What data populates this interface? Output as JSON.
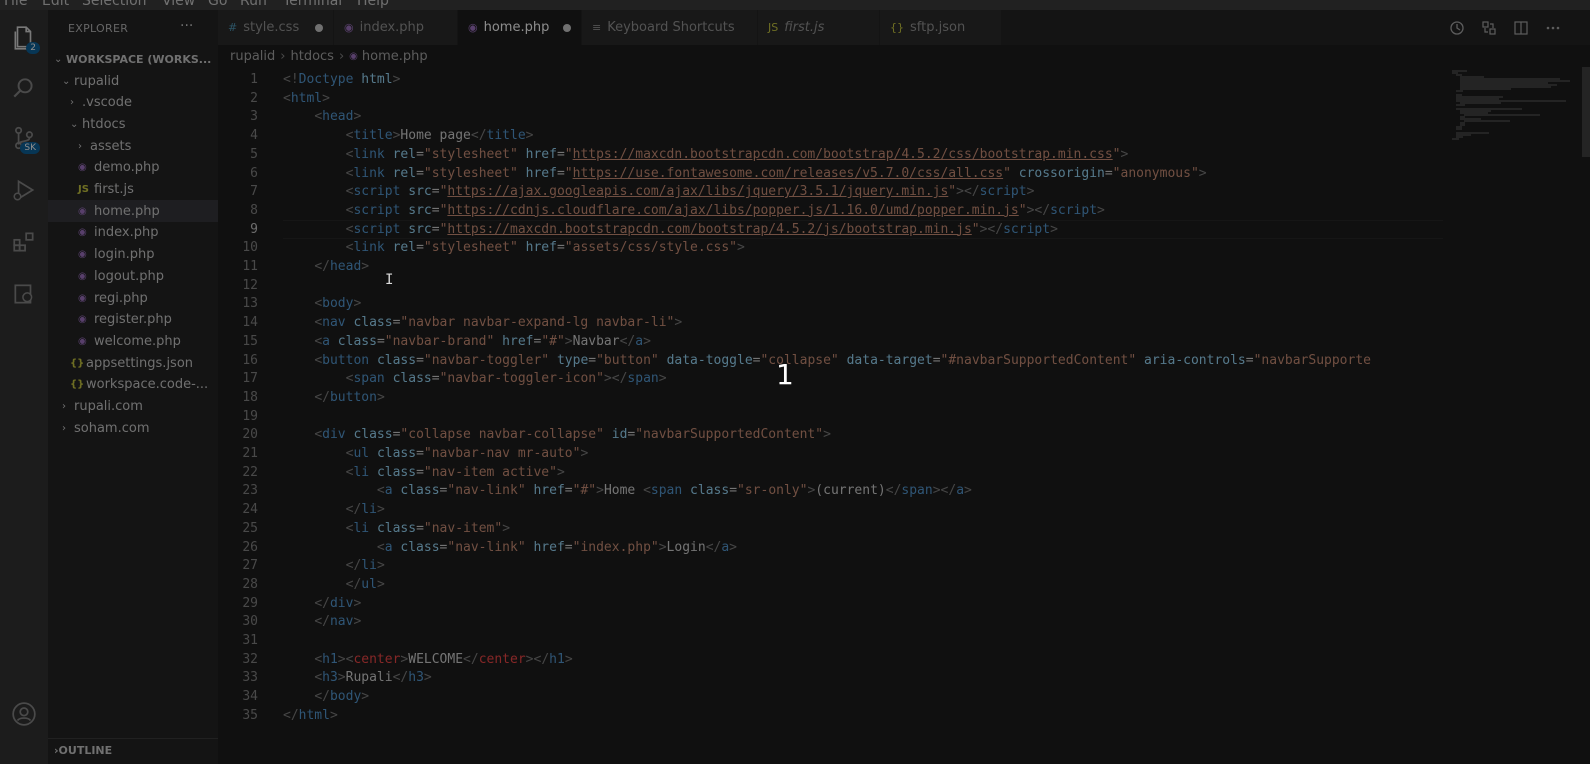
{
  "menu": [
    "File",
    "Edit",
    "Selection",
    "View",
    "Go",
    "Run",
    "Terminal",
    "Help"
  ],
  "activity_badges": {
    "explorer": "2",
    "source_control": "SK"
  },
  "sidebar": {
    "title": "EXPLORER",
    "more": "···",
    "workspace": "WORKSPACE (WORKS...",
    "tree": [
      {
        "label": "rupalid",
        "type": "folder-open",
        "indent": 1
      },
      {
        "label": ".vscode",
        "type": "folder",
        "indent": 2
      },
      {
        "label": "htdocs",
        "type": "folder-open",
        "indent": 2
      },
      {
        "label": "assets",
        "type": "folder",
        "indent": 3
      },
      {
        "label": "demo.php",
        "type": "php",
        "indent": 3
      },
      {
        "label": "first.js",
        "type": "js",
        "indent": 3
      },
      {
        "label": "home.php",
        "type": "php",
        "indent": 3,
        "selected": true
      },
      {
        "label": "index.php",
        "type": "php",
        "indent": 3
      },
      {
        "label": "login.php",
        "type": "php",
        "indent": 3
      },
      {
        "label": "logout.php",
        "type": "php",
        "indent": 3
      },
      {
        "label": "regi.php",
        "type": "php",
        "indent": 3
      },
      {
        "label": "register.php",
        "type": "php",
        "indent": 3
      },
      {
        "label": "welcome.php",
        "type": "php",
        "indent": 3
      },
      {
        "label": "appsettings.json",
        "type": "json",
        "indent": 2
      },
      {
        "label": "workspace.code-...",
        "type": "json",
        "indent": 2
      },
      {
        "label": "rupali.com",
        "type": "folder",
        "indent": 1
      },
      {
        "label": "soham.com",
        "type": "folder",
        "indent": 1
      }
    ],
    "outline": "OUTLINE"
  },
  "tabs": [
    {
      "label": "style.css",
      "icon": "#",
      "modified": true
    },
    {
      "label": "index.php",
      "icon": "php",
      "modified": false
    },
    {
      "label": "home.php",
      "icon": "php",
      "modified": true,
      "active": true
    },
    {
      "label": "Keyboard Shortcuts",
      "icon": "≡",
      "modified": false
    },
    {
      "label": "first.js",
      "icon": "JS",
      "modified": false,
      "italic": true
    },
    {
      "label": "sftp.json",
      "icon": "{}",
      "modified": false
    }
  ],
  "breadcrumbs": [
    "rupalid",
    "htdocs",
    "home.php"
  ],
  "line_numbers": [
    "1",
    "2",
    "3",
    "4",
    "5",
    "6",
    "7",
    "8",
    "9",
    "10",
    "11",
    "12",
    "13",
    "14",
    "15",
    "16",
    "17",
    "18",
    "19",
    "20",
    "21",
    "22",
    "23",
    "24",
    "25",
    "26",
    "27",
    "28",
    "29",
    "30",
    "31",
    "32",
    "33",
    "34",
    "35"
  ],
  "current_line": "9",
  "overlay_number": "1",
  "ibeam": "I",
  "colors": {
    "keyword": "#569cd6",
    "attr": "#9cdcfe",
    "string": "#ce9178",
    "punct": "#808080",
    "text": "#d4d4d4",
    "error": "#f44747"
  },
  "code_lines": [
    [
      [
        "p",
        "<!"
      ],
      [
        "t",
        "Doctype"
      ],
      [
        "x",
        " "
      ],
      [
        "a",
        "html"
      ],
      [
        "p",
        ">"
      ]
    ],
    [
      [
        "p",
        "<"
      ],
      [
        "t",
        "html"
      ],
      [
        "p",
        ">"
      ]
    ],
    [
      [
        "x",
        "    "
      ],
      [
        "p",
        "<"
      ],
      [
        "t",
        "head"
      ],
      [
        "p",
        ">"
      ]
    ],
    [
      [
        "x",
        "        "
      ],
      [
        "p",
        "<"
      ],
      [
        "t",
        "title"
      ],
      [
        "p",
        ">"
      ],
      [
        "x",
        "Home page"
      ],
      [
        "p",
        "</"
      ],
      [
        "t",
        "title"
      ],
      [
        "p",
        ">"
      ]
    ],
    [
      [
        "x",
        "        "
      ],
      [
        "p",
        "<"
      ],
      [
        "t",
        "link"
      ],
      [
        "x",
        " "
      ],
      [
        "a",
        "rel"
      ],
      [
        "x",
        "="
      ],
      [
        "s",
        "\"stylesheet\""
      ],
      [
        "x",
        " "
      ],
      [
        "a",
        "href"
      ],
      [
        "x",
        "="
      ],
      [
        "s",
        "\""
      ],
      [
        "su",
        "https://maxcdn.bootstrapcdn.com/bootstrap/4.5.2/css/bootstrap.min.css"
      ],
      [
        "s",
        "\""
      ],
      [
        "p",
        ">"
      ]
    ],
    [
      [
        "x",
        "        "
      ],
      [
        "p",
        "<"
      ],
      [
        "t",
        "link"
      ],
      [
        "x",
        " "
      ],
      [
        "a",
        "rel"
      ],
      [
        "x",
        "="
      ],
      [
        "s",
        "\"stylesheet\""
      ],
      [
        "x",
        " "
      ],
      [
        "a",
        "href"
      ],
      [
        "x",
        "="
      ],
      [
        "s",
        "\""
      ],
      [
        "su",
        "https://use.fontawesome.com/releases/v5.7.0/css/all.css"
      ],
      [
        "s",
        "\""
      ],
      [
        "x",
        " "
      ],
      [
        "a",
        "crossorigin"
      ],
      [
        "x",
        "="
      ],
      [
        "s",
        "\"anonymous\""
      ],
      [
        "p",
        ">"
      ]
    ],
    [
      [
        "x",
        "        "
      ],
      [
        "p",
        "<"
      ],
      [
        "t",
        "script"
      ],
      [
        "x",
        " "
      ],
      [
        "a",
        "src"
      ],
      [
        "x",
        "="
      ],
      [
        "s",
        "\""
      ],
      [
        "su",
        "https://ajax.googleapis.com/ajax/libs/jquery/3.5.1/jquery.min.js"
      ],
      [
        "s",
        "\""
      ],
      [
        "p",
        "></"
      ],
      [
        "t",
        "script"
      ],
      [
        "p",
        ">"
      ]
    ],
    [
      [
        "x",
        "        "
      ],
      [
        "p",
        "<"
      ],
      [
        "t",
        "script"
      ],
      [
        "x",
        " "
      ],
      [
        "a",
        "src"
      ],
      [
        "x",
        "="
      ],
      [
        "s",
        "\""
      ],
      [
        "su",
        "https://cdnjs.cloudflare.com/ajax/libs/popper.js/1.16.0/umd/popper.min.js"
      ],
      [
        "s",
        "\""
      ],
      [
        "p",
        "></"
      ],
      [
        "t",
        "script"
      ],
      [
        "p",
        ">"
      ]
    ],
    [
      [
        "x",
        "        "
      ],
      [
        "p",
        "<"
      ],
      [
        "t",
        "script"
      ],
      [
        "x",
        " "
      ],
      [
        "a",
        "src"
      ],
      [
        "x",
        "="
      ],
      [
        "s",
        "\""
      ],
      [
        "su",
        "https://maxcdn.bootstrapcdn.com/bootstrap/4.5.2/js/bootstrap.min.js"
      ],
      [
        "s",
        "\""
      ],
      [
        "p",
        "></"
      ],
      [
        "t",
        "script"
      ],
      [
        "p",
        ">"
      ]
    ],
    [
      [
        "x",
        "        "
      ],
      [
        "p",
        "<"
      ],
      [
        "t",
        "link"
      ],
      [
        "x",
        " "
      ],
      [
        "a",
        "rel"
      ],
      [
        "x",
        "="
      ],
      [
        "s",
        "\"stylesheet\""
      ],
      [
        "x",
        " "
      ],
      [
        "a",
        "href"
      ],
      [
        "x",
        "="
      ],
      [
        "s",
        "\"assets/css/style.css\""
      ],
      [
        "p",
        ">"
      ]
    ],
    [
      [
        "x",
        "    "
      ],
      [
        "p",
        "</"
      ],
      [
        "t",
        "head"
      ],
      [
        "p",
        ">"
      ]
    ],
    [],
    [
      [
        "x",
        "    "
      ],
      [
        "p",
        "<"
      ],
      [
        "t",
        "body"
      ],
      [
        "p",
        ">"
      ]
    ],
    [
      [
        "x",
        "    "
      ],
      [
        "p",
        "<"
      ],
      [
        "t",
        "nav"
      ],
      [
        "x",
        " "
      ],
      [
        "a",
        "class"
      ],
      [
        "x",
        "="
      ],
      [
        "s",
        "\"navbar navbar-expand-lg navbar-li\""
      ],
      [
        "p",
        ">"
      ]
    ],
    [
      [
        "x",
        "    "
      ],
      [
        "p",
        "<"
      ],
      [
        "t",
        "a"
      ],
      [
        "x",
        " "
      ],
      [
        "a",
        "class"
      ],
      [
        "x",
        "="
      ],
      [
        "s",
        "\"navbar-brand\""
      ],
      [
        "x",
        " "
      ],
      [
        "a",
        "href"
      ],
      [
        "x",
        "="
      ],
      [
        "s",
        "\"#\""
      ],
      [
        "p",
        ">"
      ],
      [
        "x",
        "Navbar"
      ],
      [
        "p",
        "</"
      ],
      [
        "t",
        "a"
      ],
      [
        "p",
        ">"
      ]
    ],
    [
      [
        "x",
        "    "
      ],
      [
        "p",
        "<"
      ],
      [
        "t",
        "button"
      ],
      [
        "x",
        " "
      ],
      [
        "a",
        "class"
      ],
      [
        "x",
        "="
      ],
      [
        "s",
        "\"navbar-toggler\""
      ],
      [
        "x",
        " "
      ],
      [
        "a",
        "type"
      ],
      [
        "x",
        "="
      ],
      [
        "s",
        "\"button\""
      ],
      [
        "x",
        " "
      ],
      [
        "a",
        "data-toggle"
      ],
      [
        "x",
        "="
      ],
      [
        "s",
        "\"collapse\""
      ],
      [
        "x",
        " "
      ],
      [
        "a",
        "data-target"
      ],
      [
        "x",
        "="
      ],
      [
        "s",
        "\"#navbarSupportedContent\""
      ],
      [
        "x",
        " "
      ],
      [
        "a",
        "aria-controls"
      ],
      [
        "x",
        "="
      ],
      [
        "s",
        "\"navbarSupporte"
      ]
    ],
    [
      [
        "x",
        "        "
      ],
      [
        "p",
        "<"
      ],
      [
        "t",
        "span"
      ],
      [
        "x",
        " "
      ],
      [
        "a",
        "class"
      ],
      [
        "x",
        "="
      ],
      [
        "s",
        "\"navbar-toggler-icon\""
      ],
      [
        "p",
        "></"
      ],
      [
        "t",
        "span"
      ],
      [
        "p",
        ">"
      ]
    ],
    [
      [
        "x",
        "    "
      ],
      [
        "p",
        "</"
      ],
      [
        "t",
        "button"
      ],
      [
        "p",
        ">"
      ]
    ],
    [],
    [
      [
        "x",
        "    "
      ],
      [
        "p",
        "<"
      ],
      [
        "t",
        "div"
      ],
      [
        "x",
        " "
      ],
      [
        "a",
        "class"
      ],
      [
        "x",
        "="
      ],
      [
        "s",
        "\"collapse navbar-collapse\""
      ],
      [
        "x",
        " "
      ],
      [
        "a",
        "id"
      ],
      [
        "x",
        "="
      ],
      [
        "s",
        "\"navbarSupportedContent\""
      ],
      [
        "p",
        ">"
      ]
    ],
    [
      [
        "x",
        "        "
      ],
      [
        "p",
        "<"
      ],
      [
        "t",
        "ul"
      ],
      [
        "x",
        " "
      ],
      [
        "a",
        "class"
      ],
      [
        "x",
        "="
      ],
      [
        "s",
        "\"navbar-nav mr-auto\""
      ],
      [
        "p",
        ">"
      ]
    ],
    [
      [
        "x",
        "        "
      ],
      [
        "p",
        "<"
      ],
      [
        "t",
        "li"
      ],
      [
        "x",
        " "
      ],
      [
        "a",
        "class"
      ],
      [
        "x",
        "="
      ],
      [
        "s",
        "\"nav-item active\""
      ],
      [
        "p",
        ">"
      ]
    ],
    [
      [
        "x",
        "            "
      ],
      [
        "p",
        "<"
      ],
      [
        "t",
        "a"
      ],
      [
        "x",
        " "
      ],
      [
        "a",
        "class"
      ],
      [
        "x",
        "="
      ],
      [
        "s",
        "\"nav-link\""
      ],
      [
        "x",
        " "
      ],
      [
        "a",
        "href"
      ],
      [
        "x",
        "="
      ],
      [
        "s",
        "\"#\""
      ],
      [
        "p",
        ">"
      ],
      [
        "x",
        "Home "
      ],
      [
        "p",
        "<"
      ],
      [
        "t",
        "span"
      ],
      [
        "x",
        " "
      ],
      [
        "a",
        "class"
      ],
      [
        "x",
        "="
      ],
      [
        "s",
        "\"sr-only\""
      ],
      [
        "p",
        ">"
      ],
      [
        "x",
        "(current)"
      ],
      [
        "p",
        "</"
      ],
      [
        "t",
        "span"
      ],
      [
        "p",
        "></"
      ],
      [
        "t",
        "a"
      ],
      [
        "p",
        ">"
      ]
    ],
    [
      [
        "x",
        "        "
      ],
      [
        "p",
        "</"
      ],
      [
        "t",
        "li"
      ],
      [
        "p",
        ">"
      ]
    ],
    [
      [
        "x",
        "        "
      ],
      [
        "p",
        "<"
      ],
      [
        "t",
        "li"
      ],
      [
        "x",
        " "
      ],
      [
        "a",
        "class"
      ],
      [
        "x",
        "="
      ],
      [
        "s",
        "\"nav-item\""
      ],
      [
        "p",
        ">"
      ]
    ],
    [
      [
        "x",
        "            "
      ],
      [
        "p",
        "<"
      ],
      [
        "t",
        "a"
      ],
      [
        "x",
        " "
      ],
      [
        "a",
        "class"
      ],
      [
        "x",
        "="
      ],
      [
        "s",
        "\"nav-link\""
      ],
      [
        "x",
        " "
      ],
      [
        "a",
        "href"
      ],
      [
        "x",
        "="
      ],
      [
        "s",
        "\"index.php\""
      ],
      [
        "p",
        ">"
      ],
      [
        "x",
        "Login"
      ],
      [
        "p",
        "</"
      ],
      [
        "t",
        "a"
      ],
      [
        "p",
        ">"
      ]
    ],
    [
      [
        "x",
        "        "
      ],
      [
        "p",
        "</"
      ],
      [
        "t",
        "li"
      ],
      [
        "p",
        ">"
      ]
    ],
    [
      [
        "x",
        "        "
      ],
      [
        "p",
        "</"
      ],
      [
        "t",
        "ul"
      ],
      [
        "p",
        ">"
      ]
    ],
    [
      [
        "x",
        "    "
      ],
      [
        "p",
        "</"
      ],
      [
        "t",
        "div"
      ],
      [
        "p",
        ">"
      ]
    ],
    [
      [
        "x",
        "    "
      ],
      [
        "p",
        "</"
      ],
      [
        "t",
        "nav"
      ],
      [
        "p",
        ">"
      ]
    ],
    [],
    [
      [
        "x",
        "    "
      ],
      [
        "p",
        "<"
      ],
      [
        "t",
        "h1"
      ],
      [
        "p",
        ">"
      ],
      [
        "p",
        "<"
      ],
      [
        "r",
        "center"
      ],
      [
        "p",
        ">"
      ],
      [
        "x",
        "WELCOME"
      ],
      [
        "p",
        "</"
      ],
      [
        "r",
        "center"
      ],
      [
        "p",
        "></"
      ],
      [
        "t",
        "h1"
      ],
      [
        "p",
        ">"
      ]
    ],
    [
      [
        "x",
        "    "
      ],
      [
        "p",
        "<"
      ],
      [
        "t",
        "h3"
      ],
      [
        "p",
        ">"
      ],
      [
        "x",
        "Rupali"
      ],
      [
        "p",
        "</"
      ],
      [
        "t",
        "h3"
      ],
      [
        "p",
        ">"
      ]
    ],
    [
      [
        "x",
        "    "
      ],
      [
        "p",
        "</"
      ],
      [
        "t",
        "body"
      ],
      [
        "p",
        ">"
      ]
    ],
    [
      [
        "p",
        "</"
      ],
      [
        "t",
        "html"
      ],
      [
        "p",
        ">"
      ]
    ]
  ]
}
